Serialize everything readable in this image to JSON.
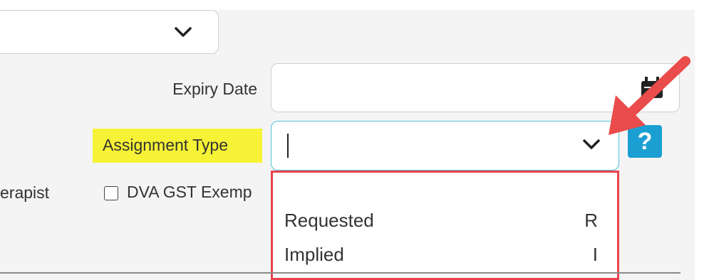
{
  "form": {
    "expiry_label": "Expiry Date",
    "expiry_value": "",
    "assignment_label": "Assignment Type",
    "assignment_value": "",
    "help_label": "?",
    "partial_label": "erapist",
    "dva_checkbox_label": "DVA GST Exemp",
    "dva_checked": false
  },
  "dropdown": {
    "options": [
      {
        "label": "",
        "code": ""
      },
      {
        "label": "Requested",
        "code": "R"
      },
      {
        "label": "Implied",
        "code": "I"
      }
    ]
  },
  "colors": {
    "highlight": "#f6f235",
    "focus_border": "#4fc3d6",
    "dropdown_border": "#e8424d",
    "help_button": "#1b9fd2",
    "arrow": "#ea4b4b"
  },
  "icons": {
    "chevron": "chevron-down-icon",
    "calendar": "calendar-icon",
    "arrow": "annotation-arrow"
  }
}
